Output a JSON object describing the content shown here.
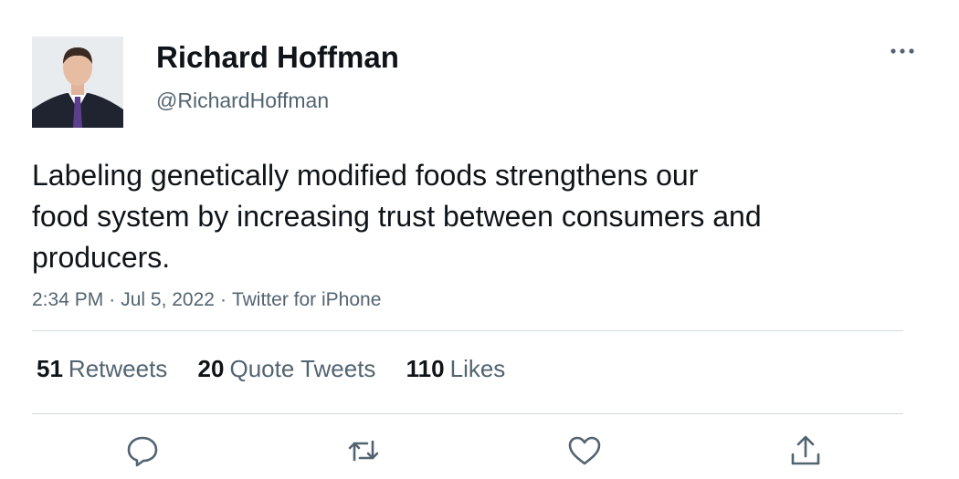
{
  "author": {
    "display_name": "Richard Hoffman",
    "handle": "@RichardHoffman"
  },
  "tweet": {
    "text_lines": [
      "Labeling genetically modified foods strengthens our",
      "food system by increasing trust between consumers and",
      "producers."
    ],
    "time": "2:34 PM",
    "date": "Jul 5, 2022",
    "source": "Twitter for iPhone",
    "separator": "·"
  },
  "stats": {
    "retweets": {
      "count": "51",
      "label": "Retweets"
    },
    "quotes": {
      "count": "20",
      "label": "Quote Tweets"
    },
    "likes": {
      "count": "110",
      "label": "Likes"
    }
  },
  "icons": {
    "more": "more-dots-icon",
    "reply": "reply-icon",
    "retweet": "retweet-icon",
    "like": "heart-icon",
    "share": "share-icon"
  },
  "colors": {
    "text_primary": "#0f1419",
    "text_secondary": "#536471",
    "divider": "#cfd9de",
    "icon": "#536471"
  }
}
